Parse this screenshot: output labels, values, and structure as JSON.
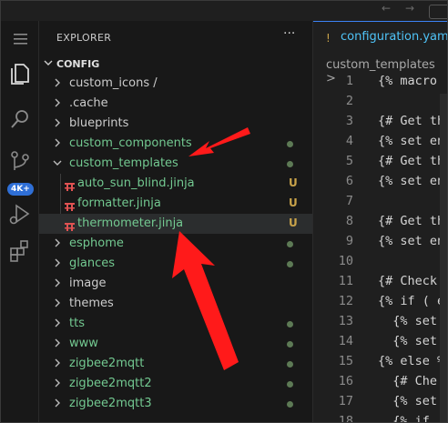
{
  "explorer": {
    "title": "EXPLORER",
    "more": "···",
    "root": "CONFIG",
    "items": [
      {
        "name": "custom_icons",
        "suffix": "/",
        "kind": "folder",
        "state": "closed",
        "color": "#cccccc",
        "status": ""
      },
      {
        "name": ".cache",
        "kind": "folder",
        "state": "closed",
        "color": "#cccccc",
        "status": ""
      },
      {
        "name": "blueprints",
        "kind": "folder",
        "state": "closed",
        "color": "#cccccc",
        "status": ""
      },
      {
        "name": "custom_components",
        "kind": "folder",
        "state": "closed",
        "color": "#73c991",
        "status": "dot"
      },
      {
        "name": "custom_templates",
        "kind": "folder",
        "state": "open",
        "color": "#73c991",
        "status": "dot"
      },
      {
        "name": "auto_sun_blind.jinja",
        "kind": "file",
        "color": "#73c991",
        "status": "U"
      },
      {
        "name": "formatter.jinja",
        "kind": "file",
        "color": "#73c991",
        "status": "U"
      },
      {
        "name": "thermometer.jinja",
        "kind": "file",
        "color": "#73c991",
        "status": "U",
        "selected": true
      },
      {
        "name": "esphome",
        "kind": "folder",
        "state": "closed",
        "color": "#73c991",
        "status": "dot"
      },
      {
        "name": "glances",
        "kind": "folder",
        "state": "closed",
        "color": "#73c991",
        "status": "dot"
      },
      {
        "name": "image",
        "kind": "folder",
        "state": "closed",
        "color": "#cccccc",
        "status": ""
      },
      {
        "name": "themes",
        "kind": "folder",
        "state": "closed",
        "color": "#cccccc",
        "status": ""
      },
      {
        "name": "tts",
        "kind": "folder",
        "state": "closed",
        "color": "#73c991",
        "status": "dot"
      },
      {
        "name": "www",
        "kind": "folder",
        "state": "closed",
        "color": "#73c991",
        "status": "dot"
      },
      {
        "name": "zigbee2mqtt",
        "kind": "folder",
        "state": "closed",
        "color": "#73c991",
        "status": "dot"
      },
      {
        "name": "zigbee2mqtt2",
        "kind": "folder",
        "state": "closed",
        "color": "#73c991",
        "status": "dot"
      },
      {
        "name": "zigbee2mqtt3",
        "kind": "folder",
        "state": "closed",
        "color": "#73c991",
        "status": "dot"
      }
    ]
  },
  "activity": {
    "icons": [
      "menu-icon",
      "files-icon",
      "search-icon",
      "source-control-icon",
      "run-debug-icon",
      "extensions-icon"
    ],
    "badge": "4K+"
  },
  "editor": {
    "tab_label": "configuration.yaml",
    "tab_icon": "!",
    "breadcrumb": "custom_templates >",
    "lines": [
      {
        "n": "1",
        "text": "{% macro"
      },
      {
        "n": "2",
        "text": ""
      },
      {
        "n": "3",
        "text": "{# Get th"
      },
      {
        "n": "4",
        "text": "{% set en"
      },
      {
        "n": "5",
        "text": "{# Get th"
      },
      {
        "n": "6",
        "text": "{% set en"
      },
      {
        "n": "7",
        "text": ""
      },
      {
        "n": "8",
        "text": "{# Get th"
      },
      {
        "n": "9",
        "text": "{% set en"
      },
      {
        "n": "10",
        "text": ""
      },
      {
        "n": "11",
        "text": "{# Check"
      },
      {
        "n": "12",
        "text": "{% if ( e"
      },
      {
        "n": "13",
        "text": "  {% set"
      },
      {
        "n": "14",
        "text": "  {% set"
      },
      {
        "n": "15",
        "text": "{% else %"
      },
      {
        "n": "16",
        "text": "  {# Che"
      },
      {
        "n": "17",
        "text": "  {% set"
      },
      {
        "n": "18",
        "text": "  {% if"
      }
    ]
  },
  "colors": {
    "accent": "#3b82f6",
    "untracked": "#73c991",
    "annotation_arrow": "#ff1a1a"
  }
}
